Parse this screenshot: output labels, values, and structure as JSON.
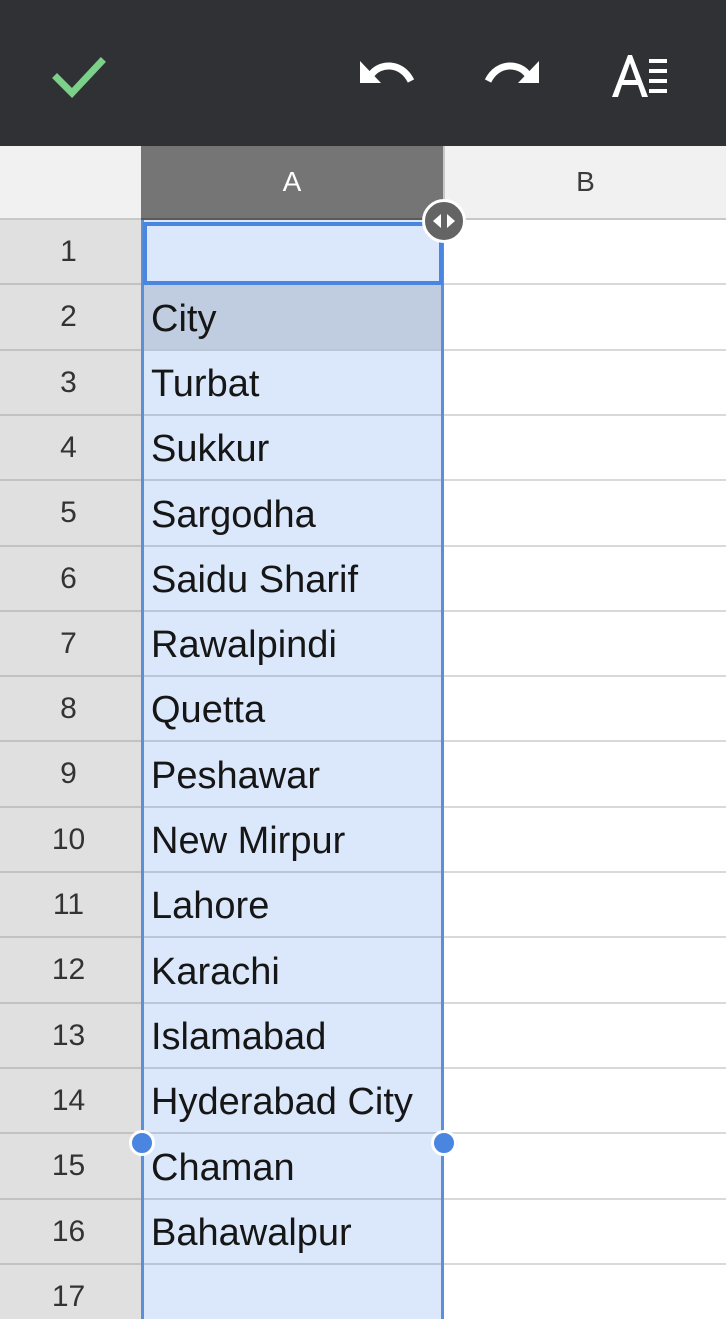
{
  "toolbar": {
    "icons": {
      "done": "check-icon",
      "undo": "undo-icon",
      "redo": "redo-icon",
      "format": "text-format-icon"
    },
    "accent": "#7bd08a"
  },
  "sheet": {
    "columns": [
      "A",
      "B"
    ],
    "selected_column": "A",
    "rows": [
      {
        "n": "1",
        "a": ""
      },
      {
        "n": "2",
        "a": "City"
      },
      {
        "n": "3",
        "a": "Turbat"
      },
      {
        "n": "4",
        "a": "Sukkur"
      },
      {
        "n": "5",
        "a": "Sargodha"
      },
      {
        "n": "6",
        "a": "Saidu Sharif"
      },
      {
        "n": "7",
        "a": "Rawalpindi"
      },
      {
        "n": "8",
        "a": "Quetta"
      },
      {
        "n": "9",
        "a": "Peshawar"
      },
      {
        "n": "10",
        "a": "New Mirpur"
      },
      {
        "n": "11",
        "a": "Lahore"
      },
      {
        "n": "12",
        "a": "Karachi"
      },
      {
        "n": "13",
        "a": "Islamabad"
      },
      {
        "n": "14",
        "a": "Hyderabad City"
      },
      {
        "n": "15",
        "a": "Chaman"
      },
      {
        "n": "16",
        "a": "Bahawalpur"
      },
      {
        "n": "17",
        "a": ""
      }
    ],
    "colors": {
      "selection": "#4a86e0",
      "selection_fill": "#dbe8fb",
      "column_header_selected": "#757575"
    }
  }
}
